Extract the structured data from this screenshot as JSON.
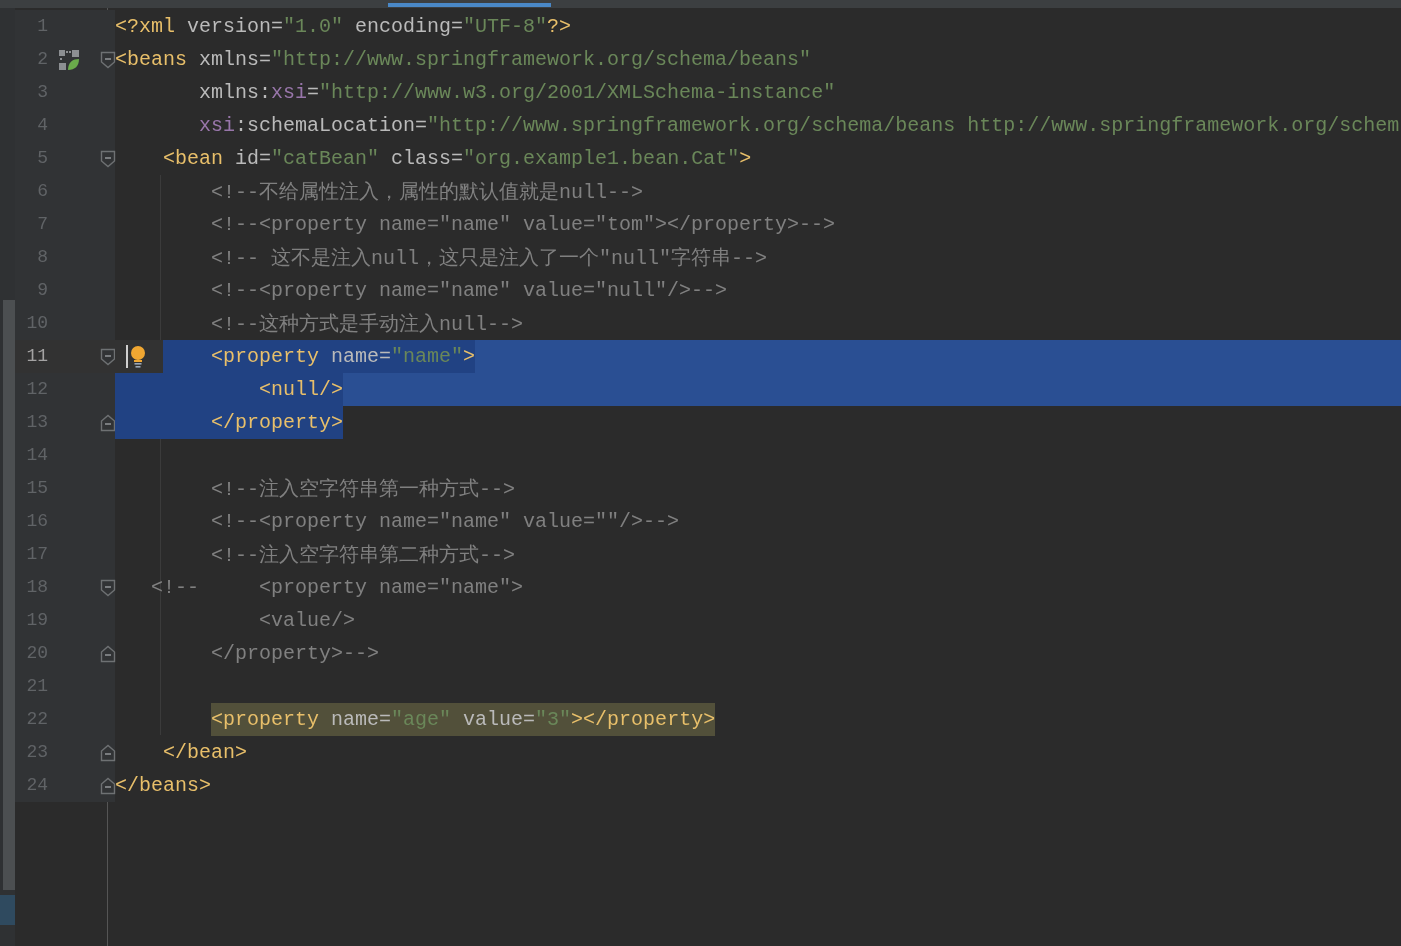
{
  "editor": {
    "lines": [
      {
        "number": "1",
        "fold_start": false,
        "fold_end": false,
        "spring_marker": false,
        "intention_bulb": false,
        "current": false,
        "selected": false,
        "selected_to_end": false,
        "highlight": false,
        "tokens": [
          {
            "text": "<?xml",
            "kind": "tag"
          },
          {
            "text": " version=",
            "kind": "attr"
          },
          {
            "text": "\"1.0\"",
            "kind": "value"
          },
          {
            "text": " encoding=",
            "kind": "attr"
          },
          {
            "text": "\"UTF-8\"",
            "kind": "value"
          },
          {
            "text": "?>",
            "kind": "tag"
          }
        ]
      },
      {
        "number": "2",
        "fold_start": true,
        "fold_end": false,
        "spring_marker": true,
        "intention_bulb": false,
        "current": false,
        "selected": false,
        "selected_to_end": false,
        "highlight": false,
        "tokens": [
          {
            "text": "<beans",
            "kind": "tag"
          },
          {
            "text": " xmlns=",
            "kind": "attr"
          },
          {
            "text": "\"http://www.springframework.org/schema/beans\"",
            "kind": "value"
          }
        ]
      },
      {
        "number": "3",
        "fold_start": false,
        "fold_end": false,
        "spring_marker": false,
        "intention_bulb": false,
        "current": false,
        "selected": false,
        "selected_to_end": false,
        "highlight": false,
        "tokens": [
          {
            "text": "       xmlns:",
            "kind": "attr"
          },
          {
            "text": "xsi",
            "kind": "ns"
          },
          {
            "text": "=",
            "kind": "attr"
          },
          {
            "text": "\"http://www.w3.org/2001/XMLSchema-instance\"",
            "kind": "value"
          }
        ]
      },
      {
        "number": "4",
        "fold_start": false,
        "fold_end": false,
        "spring_marker": false,
        "intention_bulb": false,
        "current": false,
        "selected": false,
        "selected_to_end": false,
        "highlight": false,
        "tokens": [
          {
            "text": "       xsi",
            "kind": "ns"
          },
          {
            "text": ":schemaLocation=",
            "kind": "attr"
          },
          {
            "text": "\"http://www.springframework.org/schema/beans http://www.springframework.org/schem",
            "kind": "value"
          }
        ]
      },
      {
        "number": "5",
        "fold_start": true,
        "fold_end": false,
        "spring_marker": false,
        "intention_bulb": false,
        "current": false,
        "selected": false,
        "selected_to_end": false,
        "highlight": false,
        "tokens": [
          {
            "text": "    <bean",
            "kind": "tag"
          },
          {
            "text": " id=",
            "kind": "attr"
          },
          {
            "text": "\"catBean\"",
            "kind": "value"
          },
          {
            "text": " class=",
            "kind": "attr"
          },
          {
            "text": "\"org.example1.bean.Cat\"",
            "kind": "value"
          },
          {
            "text": ">",
            "kind": "tag"
          }
        ]
      },
      {
        "number": "6",
        "fold_start": false,
        "fold_end": false,
        "spring_marker": false,
        "intention_bulb": false,
        "current": false,
        "selected": false,
        "selected_to_end": false,
        "highlight": false,
        "tokens": [
          {
            "text": "        <!--不给属性注入，属性的默认值就是null-->",
            "kind": "comment"
          }
        ]
      },
      {
        "number": "7",
        "fold_start": false,
        "fold_end": false,
        "spring_marker": false,
        "intention_bulb": false,
        "current": false,
        "selected": false,
        "selected_to_end": false,
        "highlight": false,
        "tokens": [
          {
            "text": "        <!--<property name=\"name\" value=\"tom\"></property>-->",
            "kind": "comment"
          }
        ]
      },
      {
        "number": "8",
        "fold_start": false,
        "fold_end": false,
        "spring_marker": false,
        "intention_bulb": false,
        "current": false,
        "selected": false,
        "selected_to_end": false,
        "highlight": false,
        "tokens": [
          {
            "text": "        <!-- 这不是注入null，这只是注入了一个\"null\"字符串-->",
            "kind": "comment"
          }
        ]
      },
      {
        "number": "9",
        "fold_start": false,
        "fold_end": false,
        "spring_marker": false,
        "intention_bulb": false,
        "current": false,
        "selected": false,
        "selected_to_end": false,
        "highlight": false,
        "tokens": [
          {
            "text": "        <!--<property name=\"name\" value=\"null\"/>-->",
            "kind": "comment"
          }
        ]
      },
      {
        "number": "10",
        "fold_start": false,
        "fold_end": false,
        "spring_marker": false,
        "intention_bulb": false,
        "current": false,
        "selected": false,
        "selected_to_end": false,
        "highlight": false,
        "tokens": [
          {
            "text": "        <!--这种方式是手动注入null-->",
            "kind": "comment"
          }
        ]
      },
      {
        "number": "11",
        "fold_start": true,
        "fold_end": false,
        "spring_marker": false,
        "intention_bulb": true,
        "current": true,
        "selected": true,
        "selected_to_end": true,
        "highlight": false,
        "tokens": [
          {
            "text": "        <property",
            "kind": "tag"
          },
          {
            "text": " name=",
            "kind": "attr"
          },
          {
            "text": "\"name\"",
            "kind": "value"
          },
          {
            "text": ">",
            "kind": "tag"
          }
        ]
      },
      {
        "number": "12",
        "fold_start": false,
        "fold_end": false,
        "spring_marker": false,
        "intention_bulb": false,
        "current": false,
        "selected": true,
        "selected_to_end": true,
        "highlight": false,
        "tokens": [
          {
            "text": "            <null/>",
            "kind": "tag"
          }
        ]
      },
      {
        "number": "13",
        "fold_start": false,
        "fold_end": true,
        "spring_marker": false,
        "intention_bulb": false,
        "current": false,
        "selected": true,
        "selected_to_end": false,
        "highlight": false,
        "tokens": [
          {
            "text": "        </property>",
            "kind": "tag"
          }
        ]
      },
      {
        "number": "14",
        "fold_start": false,
        "fold_end": false,
        "spring_marker": false,
        "intention_bulb": false,
        "current": false,
        "selected": false,
        "selected_to_end": false
      },
      {
        "number": "15",
        "fold_start": false,
        "fold_end": false,
        "spring_marker": false,
        "intention_bulb": false,
        "current": false,
        "selected": false,
        "selected_to_end": false,
        "highlight": false,
        "tokens": [
          {
            "text": "        <!--注入空字符串第一种方式-->",
            "kind": "comment"
          }
        ]
      },
      {
        "number": "16",
        "fold_start": false,
        "fold_end": false,
        "spring_marker": false,
        "intention_bulb": false,
        "current": false,
        "selected": false,
        "selected_to_end": false,
        "highlight": false,
        "tokens": [
          {
            "text": "        <!--<property name=\"name\" value=\"\"/>-->",
            "kind": "comment"
          }
        ]
      },
      {
        "number": "17",
        "fold_start": false,
        "fold_end": false,
        "spring_marker": false,
        "intention_bulb": false,
        "current": false,
        "selected": false,
        "selected_to_end": false,
        "highlight": false,
        "tokens": [
          {
            "text": "        <!--注入空字符串第二种方式-->",
            "kind": "comment"
          }
        ]
      },
      {
        "number": "18",
        "fold_start": true,
        "fold_end": false,
        "spring_marker": false,
        "intention_bulb": false,
        "current": false,
        "selected": false,
        "selected_to_end": false,
        "highlight": false,
        "tokens": [
          {
            "text": "   <!--     <property name=\"name\">",
            "kind": "comment"
          }
        ]
      },
      {
        "number": "19",
        "fold_start": false,
        "fold_end": false,
        "spring_marker": false,
        "intention_bulb": false,
        "current": false,
        "selected": false,
        "selected_to_end": false,
        "highlight": false,
        "tokens": [
          {
            "text": "            <value/>",
            "kind": "comment"
          }
        ]
      },
      {
        "number": "20",
        "fold_start": false,
        "fold_end": true,
        "spring_marker": false,
        "intention_bulb": false,
        "current": false,
        "selected": false,
        "selected_to_end": false,
        "highlight": false,
        "tokens": [
          {
            "text": "        </property>-->",
            "kind": "comment"
          }
        ]
      },
      {
        "number": "21",
        "fold_start": false,
        "fold_end": false,
        "spring_marker": false,
        "intention_bulb": false,
        "current": false,
        "selected": false,
        "selected_to_end": false
      },
      {
        "number": "22",
        "fold_start": false,
        "fold_end": false,
        "spring_marker": false,
        "intention_bulb": false,
        "current": false,
        "selected": false,
        "selected_to_end": false,
        "highlight": true,
        "tokens": [
          {
            "text": "        <property",
            "kind": "tag"
          },
          {
            "text": " name=",
            "kind": "attr"
          },
          {
            "text": "\"age\"",
            "kind": "value"
          },
          {
            "text": " value=",
            "kind": "attr"
          },
          {
            "text": "\"3\"",
            "kind": "value"
          },
          {
            "text": "></property>",
            "kind": "tag"
          }
        ]
      },
      {
        "number": "23",
        "fold_start": false,
        "fold_end": true,
        "spring_marker": false,
        "intention_bulb": false,
        "current": false,
        "selected": false,
        "selected_to_end": false,
        "highlight": false,
        "tokens": [
          {
            "text": "    </bean>",
            "kind": "tag"
          }
        ]
      },
      {
        "number": "24",
        "fold_start": false,
        "fold_end": true,
        "spring_marker": false,
        "intention_bulb": false,
        "current": false,
        "selected": false,
        "selected_to_end": false,
        "highlight": false,
        "tokens": [
          {
            "text": "</beans>",
            "kind": "tag"
          }
        ]
      }
    ]
  }
}
